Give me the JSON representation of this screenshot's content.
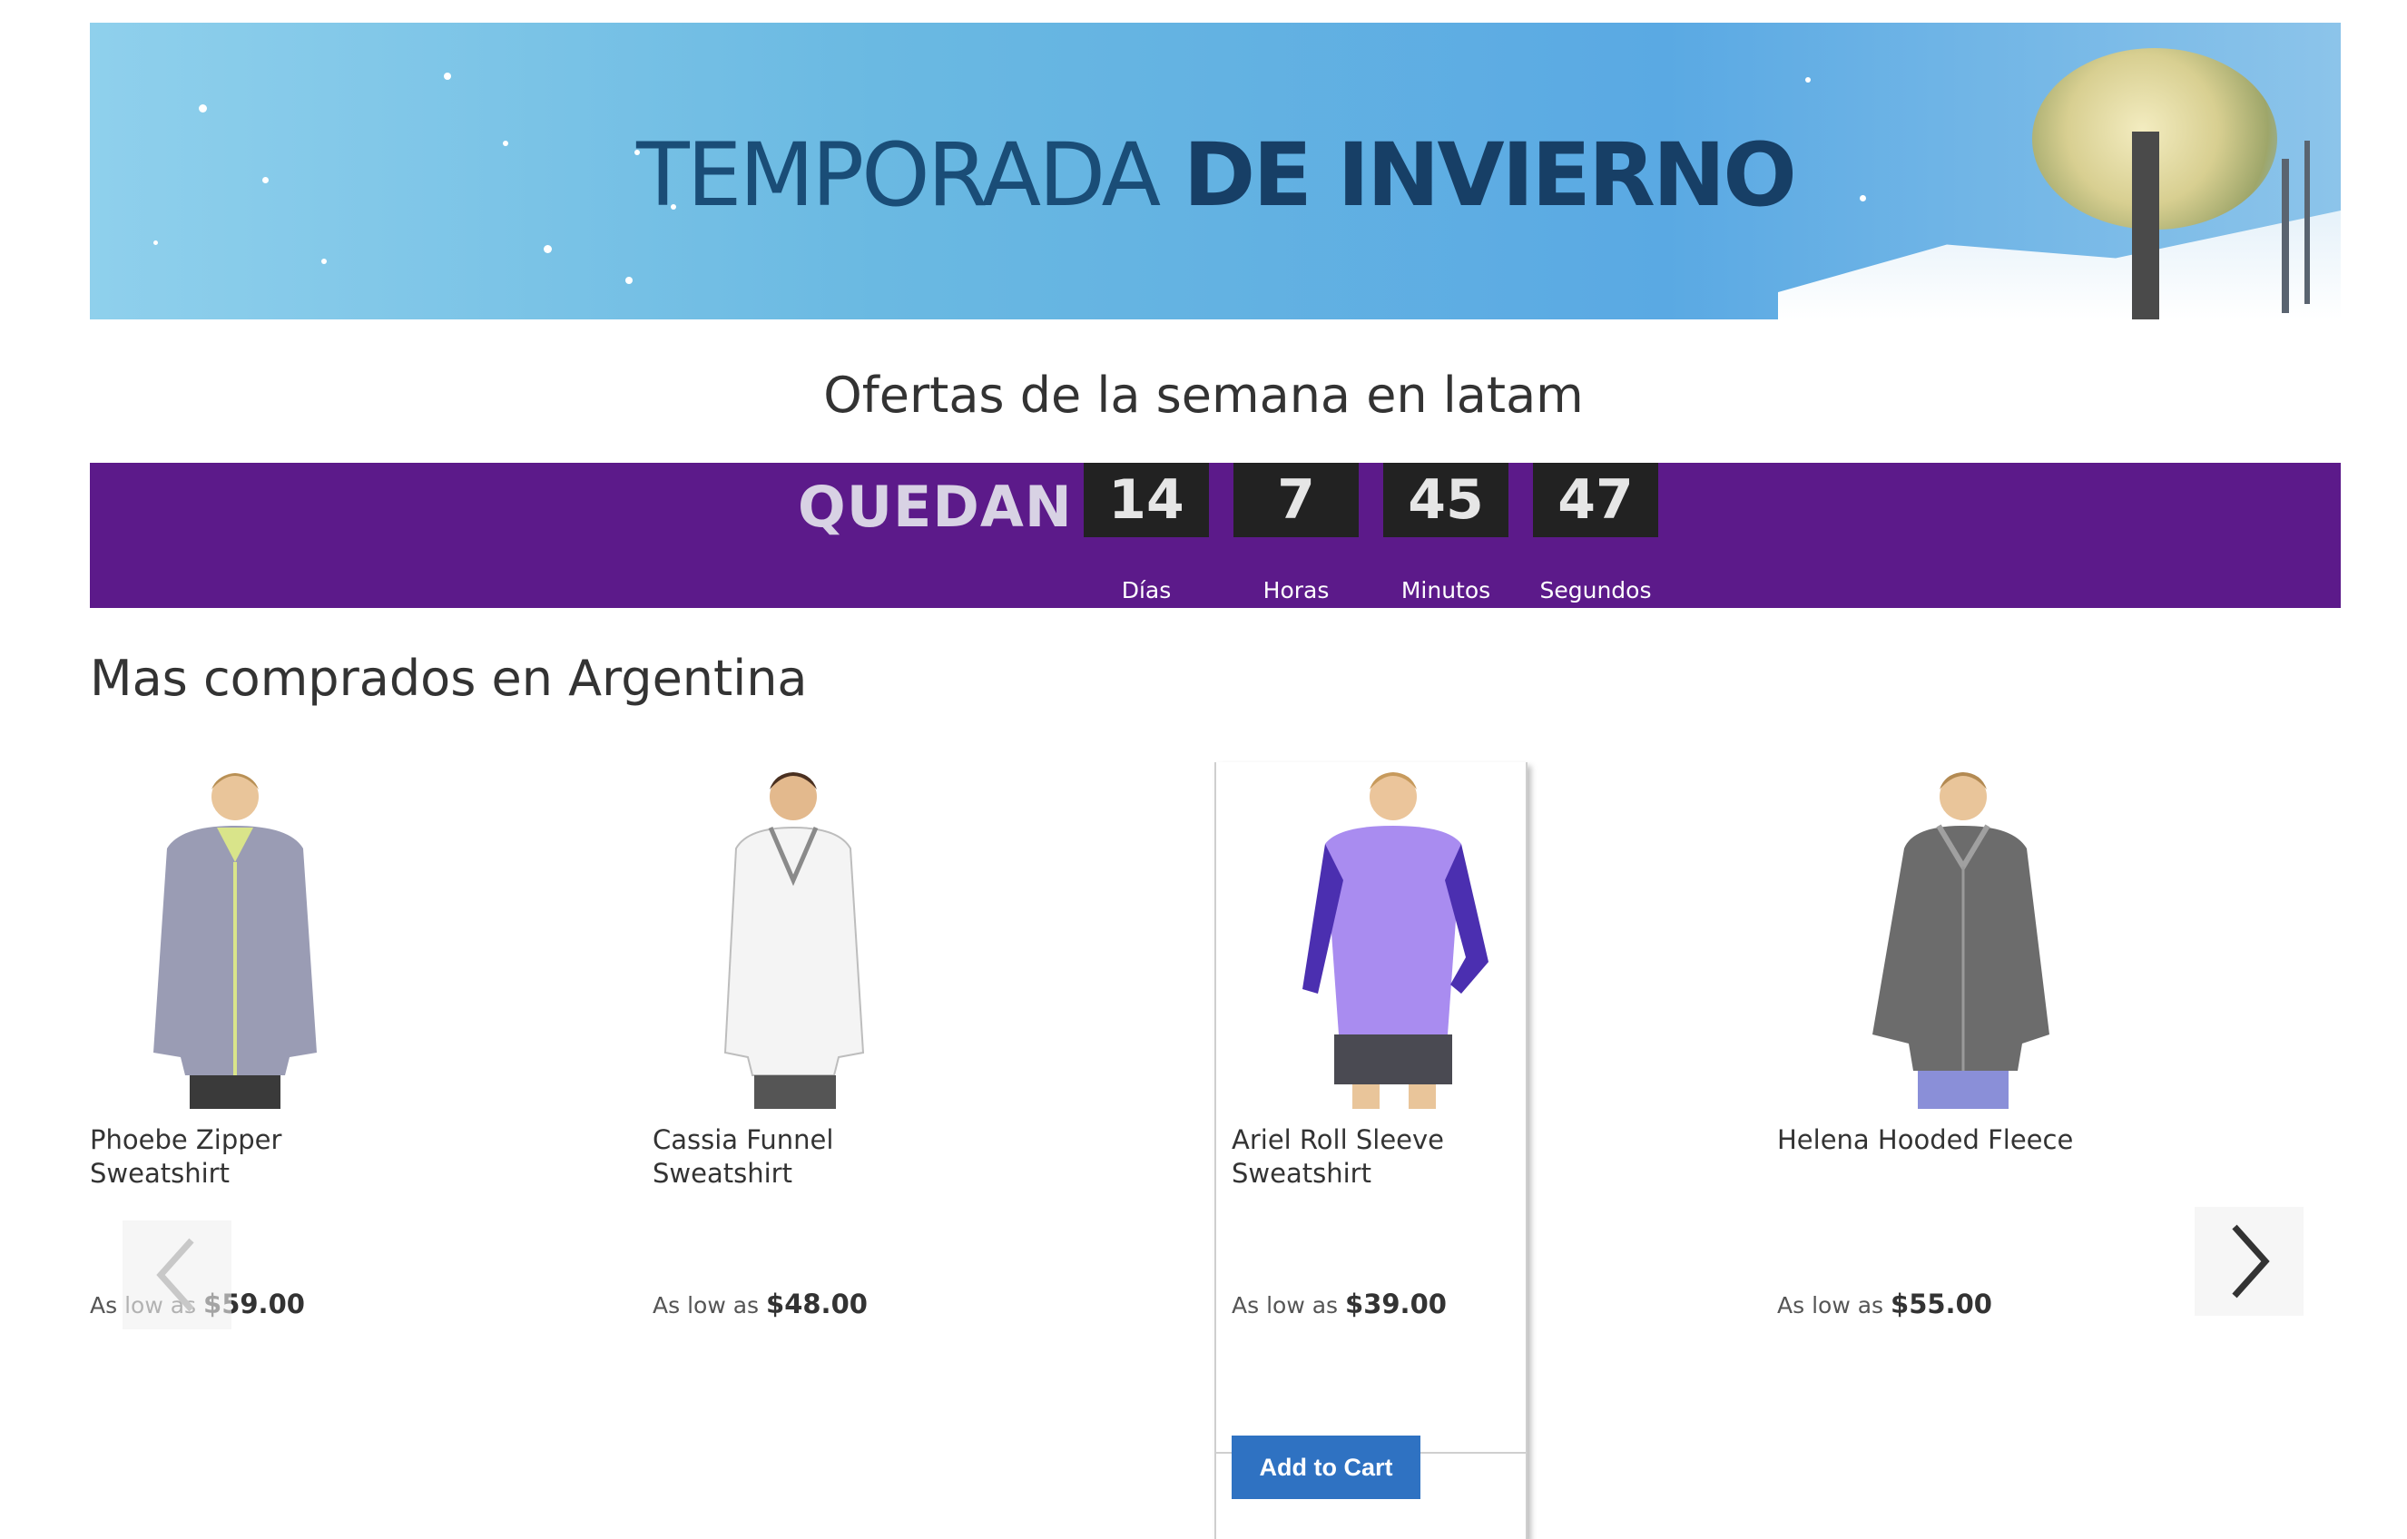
{
  "banner": {
    "title_light": "TEMPORADA",
    "title_bold": "DE INVIERNO"
  },
  "offers_title": "Ofertas de la semana en latam",
  "countdown": {
    "prefix": "QUEDAN",
    "days": {
      "value": "14",
      "label": "Días"
    },
    "hours": {
      "value": "7",
      "label": "Horas"
    },
    "minutes": {
      "value": "45",
      "label": "Minutos"
    },
    "seconds": {
      "value": "47",
      "label": "Segundos"
    },
    "background_color": "#5c1a8a"
  },
  "section_title": "Mas comprados en Argentina",
  "products": [
    {
      "name": "Phoebe Zipper Sweatshirt",
      "price_prefix": "As low as",
      "price": "$59.00",
      "jacket_color": "#9a9cb4",
      "trim_color": "#d9e48a"
    },
    {
      "name": "Cassia Funnel Sweatshirt",
      "price_prefix": "As low as",
      "price": "$48.00",
      "jacket_color": "#f4f4f4",
      "trim_color": "#8a8a8a"
    },
    {
      "name": "Ariel Roll Sleeve Sweatshirt",
      "price_prefix": "As low as",
      "price": "$39.00",
      "jacket_color": "#a98cf0",
      "trim_color": "#4b2fb0",
      "add_to_cart": "Add to Cart"
    },
    {
      "name": "Helena Hooded Fleece",
      "price_prefix": "As low as",
      "price": "$55.00",
      "jacket_color": "#6c6c6c",
      "trim_color": "#8a8fd8"
    }
  ],
  "icons": {
    "prev": "chevron-left-icon",
    "next": "chevron-right-icon"
  },
  "colors": {
    "button": "#2f72c2",
    "countdown_box": "#222222"
  }
}
